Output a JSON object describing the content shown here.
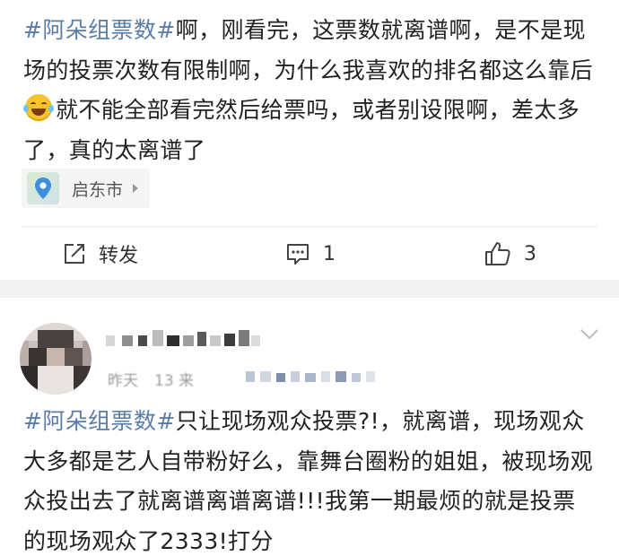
{
  "colors": {
    "hashtag": "#5a7da8",
    "text": "#222222",
    "muted": "#9a9a9a",
    "separator": "#f2f2f2"
  },
  "post1": {
    "hashtag": "#阿朵组票数#",
    "text_before_emoji": "啊，刚看完，这票数就离谱啊，是不是现场的投票次数有限制啊，为什么我喜欢的排名都这么靠后",
    "emoji": "laughing-tears-icon",
    "text_after_emoji": "就不能全部看完然后给票吗，或者别设限啊，差太多了，真的太离谱了",
    "location": "启东市",
    "actions": {
      "repost_label": "转发",
      "comment_count": "1",
      "like_count": "3"
    }
  },
  "post2": {
    "author_name_pixelated": true,
    "time_prefix": "昨天",
    "time_partial": "13 来",
    "hashtag": "#阿朵组票数#",
    "text": "只让现场观众投票?!，就离谱，现场观众大多都是艺人自带粉好么，靠舞台圈粉的姐姐，被现场观众投出去了就离谱离谱离谱!!!我第一期最烦的就是投票的现场观众了2333!打分"
  }
}
